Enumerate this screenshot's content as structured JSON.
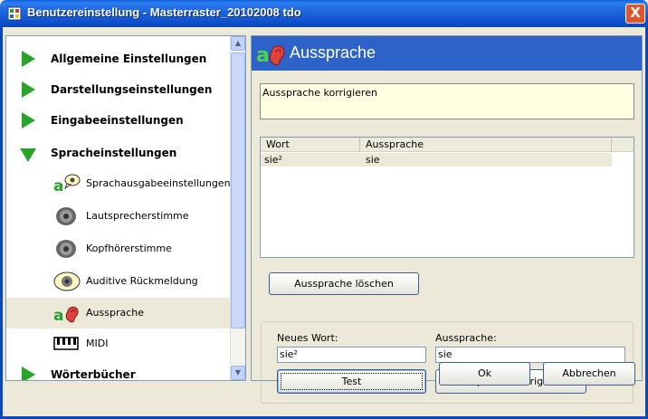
{
  "window": {
    "title": "Benutzereinstellung - Masterraster_20102008 tdo",
    "icon": "settings-grid-icon",
    "close_label": "X"
  },
  "nav": {
    "items": [
      {
        "type": "cat",
        "label": "Allgemeine Einstellungen",
        "expanded": false
      },
      {
        "type": "cat",
        "label": "Darstellungseinstellungen",
        "expanded": false
      },
      {
        "type": "cat",
        "label": "Eingabeeinstellungen",
        "expanded": false
      },
      {
        "type": "cat",
        "label": "Spracheinstellungen",
        "expanded": true
      },
      {
        "type": "sub",
        "label": "Sprachausgabeeinstellungen",
        "icon": "speech-bubble-icon"
      },
      {
        "type": "sub",
        "label": "Lautsprecherstimme",
        "icon": "speaker-icon"
      },
      {
        "type": "sub",
        "label": "Kopfhörerstimme",
        "icon": "speaker-icon"
      },
      {
        "type": "sub",
        "label": "Auditive Rückmeldung",
        "icon": "audio-feedback-icon"
      },
      {
        "type": "sub",
        "label": "Aussprache",
        "icon": "ear-icon",
        "selected": true
      },
      {
        "type": "sub",
        "label": "MIDI",
        "icon": "piano-keys-icon"
      },
      {
        "type": "cat",
        "label": "Wörterbücher",
        "expanded": false
      }
    ]
  },
  "panel": {
    "title": "Aussprache",
    "info_text": "Aussprache korrigieren",
    "list": {
      "columns": [
        "Wort",
        "Aussprache"
      ],
      "rows": [
        {
          "wort": "sie²",
          "aussprache": "sie"
        }
      ]
    },
    "delete_button": "Aussprache löschen",
    "new_word_label": "Neues Wort:",
    "new_word_value": "sie²",
    "pronunciation_label": "Aussprache:",
    "pronunciation_value": "sie",
    "test_button": "Test",
    "correct_button": "Aussprache korrigieren"
  },
  "footer": {
    "ok_label": "Ok",
    "cancel_label": "Abbrechen"
  },
  "colors": {
    "titlebar": "#1c64de",
    "panel_header": "#2d63c8",
    "info_box": "#ffffe1",
    "nav_arrow": "#2aa32a",
    "close_button": "#e2542d"
  }
}
